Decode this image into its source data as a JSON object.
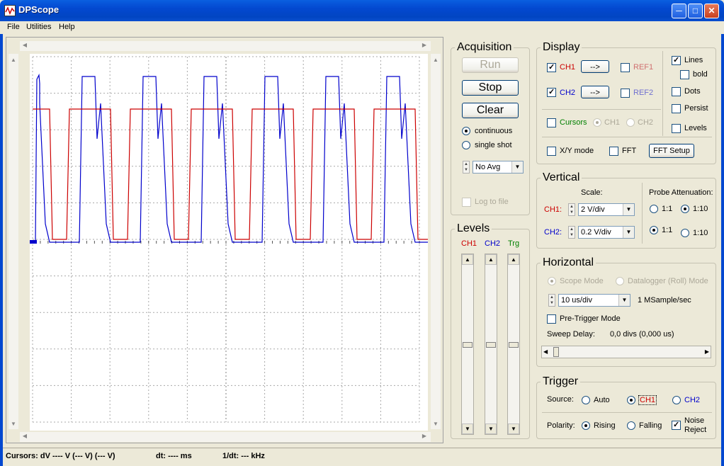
{
  "window": {
    "title": "DPScope"
  },
  "menu": [
    "File",
    "Utilities",
    "Help"
  ],
  "acquisition": {
    "title": "Acquisition",
    "run": "Run",
    "stop": "Stop",
    "clear": "Clear",
    "mode_continuous": "continuous",
    "mode_single": "single shot",
    "avg": "No Avg",
    "log": "Log to file"
  },
  "levels": {
    "title": "Levels",
    "ch1": "CH1",
    "ch2": "CH2",
    "trg": "Trg"
  },
  "display": {
    "title": "Display",
    "ch1": "CH1",
    "ch2": "CH2",
    "arrow": "-->",
    "ref1": "REF1",
    "ref2": "REF2",
    "cursors": "Cursors",
    "cur_ch1": "CH1",
    "cur_ch2": "CH2",
    "lines": "Lines",
    "bold": "bold",
    "dots": "Dots",
    "persist": "Persist",
    "levels": "Levels",
    "xy": "X/Y mode",
    "fft": "FFT",
    "fft_setup": "FFT Setup"
  },
  "vertical": {
    "title": "Vertical",
    "scale": "Scale:",
    "probe": "Probe Attenuation:",
    "ch1": "CH1:",
    "ch2": "CH2:",
    "ch1_scale": "2 V/div",
    "ch2_scale": "0.2 V/div",
    "att_1": "1:1",
    "att_10": "1:10"
  },
  "horizontal": {
    "title": "Horizontal",
    "scope_mode": "Scope Mode",
    "datalogger": "Datalogger (Roll) Mode",
    "timebase": "10 us/div",
    "rate": "1 MSample/sec",
    "pretrigger": "Pre-Trigger Mode",
    "sweep_label": "Sweep Delay:",
    "sweep_value": "0,0 divs (0,000 us)"
  },
  "trigger": {
    "title": "Trigger",
    "source": "Source:",
    "auto": "Auto",
    "ch1": "CH1",
    "ch2": "CH2",
    "polarity": "Polarity:",
    "rising": "Rising",
    "falling": "Falling",
    "noise1": "Noise",
    "noise2": "Reject"
  },
  "status": {
    "cursors": "Cursors:  dV  ---- V   (--- V)  (--- V)",
    "dt": "dt:  ---- ms",
    "inv_dt": "1/dt:  --- kHz"
  },
  "colors": {
    "ch1": "#cc0000",
    "ch2": "#0000cc",
    "trg": "#008000",
    "ref": "#d07070"
  }
}
